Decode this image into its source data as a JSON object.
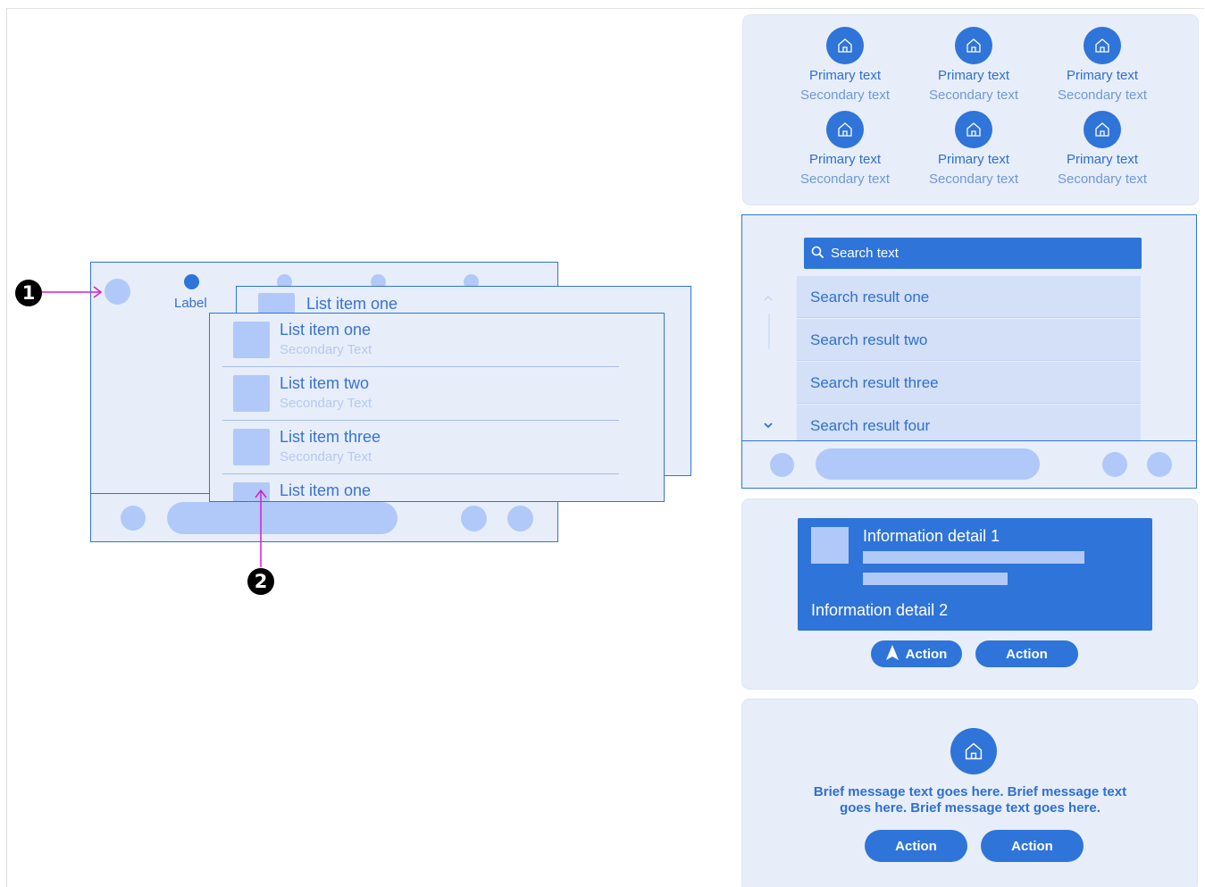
{
  "callouts": {
    "one": "1",
    "two": "2"
  },
  "nav_screen": {
    "label": "Label"
  },
  "mid_screen": {
    "first_item": "List item one"
  },
  "front_screen": {
    "items": [
      {
        "title": "List item one",
        "secondary": "Secondary Text"
      },
      {
        "title": "List item two",
        "secondary": "Secondary Text"
      },
      {
        "title": "List item three",
        "secondary": "Secondary Text"
      },
      {
        "title": "List item one",
        "secondary": ""
      }
    ]
  },
  "grid_panel": {
    "cells": [
      {
        "primary": "Primary text",
        "secondary": "Secondary text"
      },
      {
        "primary": "Primary text",
        "secondary": "Secondary text"
      },
      {
        "primary": "Primary text",
        "secondary": "Secondary text"
      },
      {
        "primary": "Primary text",
        "secondary": "Secondary text"
      },
      {
        "primary": "Primary text",
        "secondary": "Secondary text"
      },
      {
        "primary": "Primary text",
        "secondary": "Secondary text"
      }
    ]
  },
  "search_panel": {
    "query": "Search text",
    "results": [
      "Search result one",
      "Search result two",
      "Search result three",
      "Search result four"
    ]
  },
  "info_panel": {
    "detail_1": "Information detail 1",
    "detail_2": "Information detail 2",
    "action_1": "Action",
    "action_2": "Action"
  },
  "message_panel": {
    "line_1": "Brief message text goes here. Brief message text",
    "line_2": "goes here. Brief message text goes here.",
    "action_1": "Action",
    "action_2": "Action"
  },
  "colors": {
    "accent": "#2f74d9",
    "surface": "#e7eefa",
    "placeholder": "#b1c9f8",
    "callout_line": "#d21ed2"
  }
}
